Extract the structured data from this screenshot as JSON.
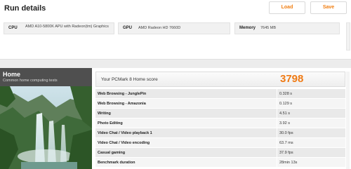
{
  "run_details": {
    "title": "Run details",
    "load_label": "Load",
    "save_label": "Save",
    "cpu_label": "CPU",
    "cpu_value": "AMD A10-5800K APU with Radeon(tm) Graphics",
    "gpu_label": "GPU",
    "gpu_value": "AMD Radeon HD 7660D",
    "memory_label": "Memory",
    "memory_value": "7645 MB"
  },
  "home": {
    "title": "Home",
    "subtitle": "Common home computing tests",
    "score_label": "Your PCMark 8 Home score",
    "score_value": "3798",
    "results": [
      {
        "name": "Web Browsing - JunglePin",
        "value": "0.328 s"
      },
      {
        "name": "Web Browsing - Amazonia",
        "value": "0.129 s"
      },
      {
        "name": "Writing",
        "value": "4.51 s"
      },
      {
        "name": "Photo Editing",
        "value": "3.92 s"
      },
      {
        "name": "Video Chat / Video playback 1",
        "value": "30.0 fps"
      },
      {
        "name": "Video Chat / Video encoding",
        "value": "63.7 ms"
      },
      {
        "name": "Casual gaming",
        "value": "37.9 fps"
      },
      {
        "name": "Benchmark duration",
        "value": "28min 13s"
      }
    ]
  },
  "colors": {
    "accent": "#ef7a14",
    "home_header": "#4f4f4f"
  }
}
